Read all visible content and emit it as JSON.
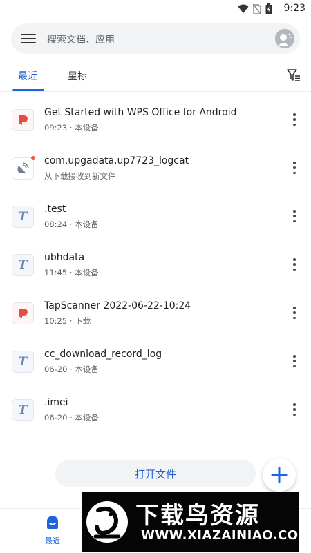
{
  "status_bar": {
    "time": "9:23",
    "icons": [
      "wifi-icon",
      "no-sim-icon",
      "battery-icon"
    ]
  },
  "search": {
    "placeholder": "搜索文档、应用"
  },
  "tabs": [
    {
      "label": "最近",
      "active": true
    },
    {
      "label": "星标",
      "active": false
    }
  ],
  "files": [
    {
      "name": "Get Started with WPS Office for Android",
      "sub": "09:23 · 本设备",
      "type": "pdf"
    },
    {
      "name": "com.upgadata.up7723_logcat",
      "sub": "从下载接收到新文件",
      "type": "received"
    },
    {
      "name": ".test",
      "sub": "08:24 · 本设备",
      "type": "txt"
    },
    {
      "name": "ubhdata",
      "sub": "11:45 · 本设备",
      "type": "txt"
    },
    {
      "name": "TapScanner 2022-06-22-10:24",
      "sub": "10:25 · 下载",
      "type": "pdf"
    },
    {
      "name": "cc_download_record_log",
      "sub": "06-20 · 本设备",
      "type": "txt"
    },
    {
      "name": ".imei",
      "sub": "06-20 · 本设备",
      "type": "txt"
    }
  ],
  "open_file_label": "打开文件",
  "bottom_nav": {
    "recent_label": "最近"
  },
  "watermark": {
    "title": "下载鸟资源",
    "url": "WWW.XIAZAINIAO.COM"
  },
  "colors": {
    "accent": "#1e64dc",
    "pdf": "#e64a4a",
    "badge": "#e85c41"
  }
}
